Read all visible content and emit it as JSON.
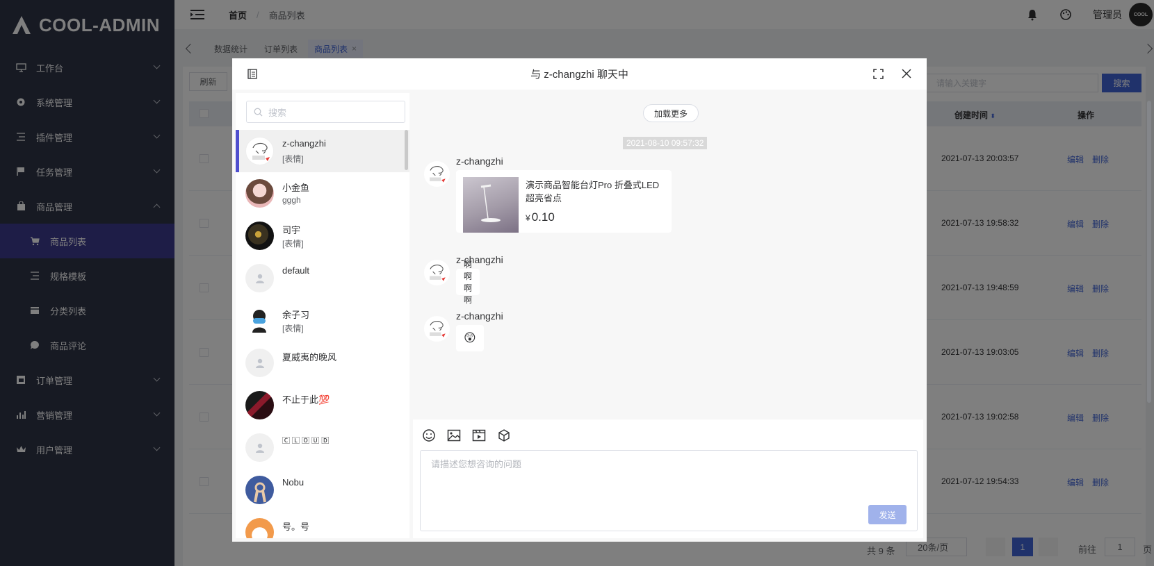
{
  "brand": {
    "name": "COOL-ADMIN"
  },
  "sidebar": {
    "items": [
      {
        "label": "工作台",
        "icon": "monitor-icon",
        "expandable": true
      },
      {
        "label": "系统管理",
        "icon": "settings-icon",
        "expandable": true
      },
      {
        "label": "插件管理",
        "icon": "list-icon",
        "expandable": true
      },
      {
        "label": "任务管理",
        "icon": "flag-icon",
        "expandable": true
      },
      {
        "label": "商品管理",
        "icon": "bag-icon",
        "expandable": true,
        "expanded": true
      },
      {
        "label": "商品列表",
        "icon": "cart-icon",
        "sub": true,
        "active": true
      },
      {
        "label": "规格模板",
        "icon": "list-icon",
        "sub": true
      },
      {
        "label": "分类列表",
        "icon": "card-icon",
        "sub": true
      },
      {
        "label": "商品评论",
        "icon": "comment-icon",
        "sub": true
      },
      {
        "label": "订单管理",
        "icon": "order-icon",
        "expandable": true
      },
      {
        "label": "营销管理",
        "icon": "chart-icon",
        "expandable": true
      },
      {
        "label": "用户管理",
        "icon": "crown-icon",
        "expandable": true
      }
    ]
  },
  "topbar": {
    "breadcrumb_home": "首页",
    "breadcrumb_sep": "/",
    "breadcrumb_current": "商品列表",
    "admin_name": "管理员",
    "avatar_text": "COOL"
  },
  "tabs": [
    {
      "label": "数据统计"
    },
    {
      "label": "订单列表"
    },
    {
      "label": "商品列表",
      "active": true,
      "close": "×"
    }
  ],
  "page": {
    "refresh_label": "刷新",
    "search_placeholder": "请输入关键字",
    "search_label": "搜索",
    "col_created": "创建时间",
    "col_ops": "操作",
    "rows": [
      {
        "time": "2021-07-13 20:03:57",
        "edit": "编辑",
        "del": "删除"
      },
      {
        "time": "2021-07-13 19:58:32",
        "edit": "编辑",
        "del": "删除"
      },
      {
        "time": "2021-07-13 19:48:59",
        "edit": "编辑",
        "del": "删除"
      },
      {
        "time": "2021-07-13 19:03:05",
        "edit": "编辑",
        "del": "删除"
      },
      {
        "time": "2021-07-13 19:02:58",
        "edit": "编辑",
        "del": "删除"
      },
      {
        "time": "2021-07-12 19:54:33",
        "edit": "编辑",
        "del": "删除"
      }
    ],
    "pager": {
      "total": "共 9 条",
      "page_size": "20条/页",
      "current": "1",
      "goto": "前往",
      "goto_value": "1",
      "page_unit": "页"
    }
  },
  "chat": {
    "title": "与 z-changzhi 聊天中",
    "search_placeholder": "搜索",
    "sessions": [
      {
        "name": "z-changzhi",
        "msg": "[表情]",
        "active": true,
        "avatar": "sketch"
      },
      {
        "name": "小金鱼",
        "msg": "gggh",
        "avatar": "pink"
      },
      {
        "name": "司宇",
        "msg": "[表情]",
        "avatar": "dark"
      },
      {
        "name": "default",
        "msg": "",
        "avatar": "default"
      },
      {
        "name": "余子习",
        "msg": "[表情]",
        "avatar": "mask"
      },
      {
        "name": "夏威夷的晚风",
        "msg": "",
        "avatar": "default"
      },
      {
        "name": "不止于此💯",
        "msg": "",
        "avatar": "red"
      },
      {
        "name": "🄲 🄻 🄾 🅄 🄳",
        "msg": "",
        "avatar": "default"
      },
      {
        "name": "Nobu",
        "msg": "",
        "avatar": "hand"
      },
      {
        "name": "号。号",
        "msg": "",
        "avatar": "orange"
      }
    ],
    "load_more": "加载更多",
    "time_tag": "2021-08-10 09:57:32",
    "messages": [
      {
        "sender": "z-changzhi",
        "type": "goods",
        "goods_title": "演示商品智能台灯Pro 折叠式LED超亮省点",
        "currency": "¥",
        "price": "0.10"
      },
      {
        "sender": "z-changzhi",
        "type": "text",
        "text": "啊啊啊啊"
      },
      {
        "sender": "z-changzhi",
        "type": "emoji",
        "text": "😲"
      }
    ],
    "input_placeholder": "请描述您想咨询的问题",
    "send_label": "发送"
  }
}
